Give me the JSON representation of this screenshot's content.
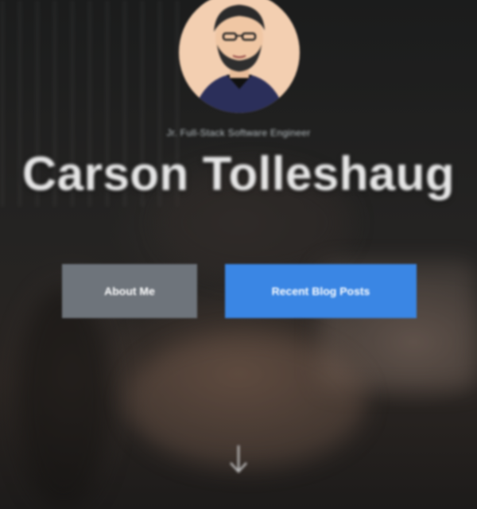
{
  "hero": {
    "subtitle": "Jr. Full-Stack Software Engineer",
    "name": "Carson Tolleshaug",
    "buttons": {
      "about_label": "About Me",
      "blog_label": "Recent Blog Posts"
    },
    "icons": {
      "avatar": "avatar-illustration",
      "scroll": "arrow-down-icon"
    }
  },
  "colors": {
    "about_button": "#6e747b",
    "blog_button": "#3a86e4",
    "avatar_background": "#f3cfb1",
    "name_text": "#e6e6e6"
  }
}
